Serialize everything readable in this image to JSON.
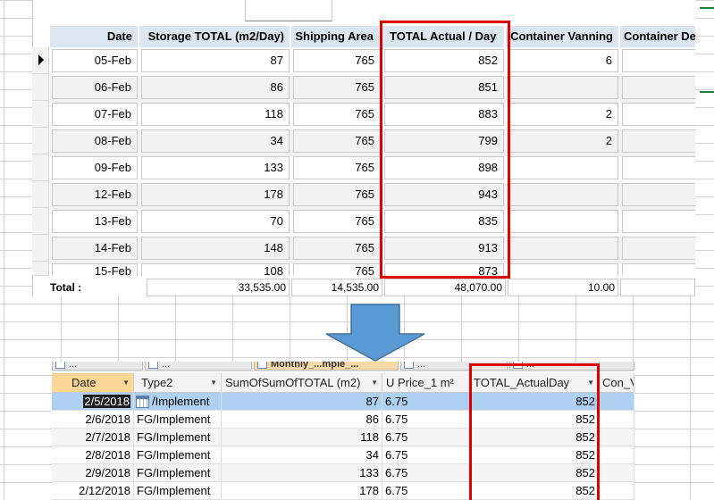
{
  "form": {
    "headers": [
      "Date",
      "Storage TOTAL (m2/Day)",
      "Shipping Area",
      "TOTAL  Actual / Day",
      "Container Vanning",
      "Container De"
    ],
    "rows": [
      [
        "05-Feb",
        "87",
        "765",
        "852",
        "6",
        ""
      ],
      [
        "06-Feb",
        "86",
        "765",
        "851",
        "",
        ""
      ],
      [
        "07-Feb",
        "118",
        "765",
        "883",
        "2",
        ""
      ],
      [
        "08-Feb",
        "34",
        "765",
        "799",
        "2",
        ""
      ],
      [
        "09-Feb",
        "133",
        "765",
        "898",
        "",
        ""
      ],
      [
        "12-Feb",
        "178",
        "765",
        "943",
        "",
        ""
      ],
      [
        "13-Feb",
        "70",
        "765",
        "835",
        "",
        ""
      ],
      [
        "14-Feb",
        "148",
        "765",
        "913",
        "",
        ""
      ],
      [
        "15-Feb",
        "108",
        "765",
        "873",
        "",
        ""
      ]
    ],
    "total_label": "Total :",
    "totals": [
      "33,535.00",
      "14,535.00",
      "48,070.00",
      "10.00"
    ]
  },
  "datasheet": {
    "tabs": [
      "...",
      "...",
      "Monthly_...mple_...",
      "...",
      "..."
    ],
    "headers": [
      "Date",
      "Type2",
      "SumOfSumOfTOTAL (m2)",
      "U Price_1 m²",
      "TOTAL_ActualDay",
      "Con_V"
    ],
    "rows": [
      [
        "2/5/2018",
        "/Implement",
        "87",
        "6.75",
        "852"
      ],
      [
        "2/6/2018",
        "FG/Implement",
        "86",
        "6.75",
        "852"
      ],
      [
        "2/7/2018",
        "FG/Implement",
        "118",
        "6.75",
        "852"
      ],
      [
        "2/8/2018",
        "FG/Implement",
        "34",
        "6.75",
        "852"
      ],
      [
        "2/9/2018",
        "FG/Implement",
        "133",
        "6.75",
        "852"
      ],
      [
        "2/12/2018",
        "FG/Implement",
        "178",
        "6.75",
        "852"
      ]
    ]
  },
  "colors": {
    "highlight": "#e00000",
    "arrow": "#5b9bd5",
    "header_blue": "#dce6f1",
    "selected_row": "#aed0f1",
    "sorted_header": "#fbd696"
  },
  "icons": [
    "record-selector-arrow-icon",
    "down-arrow-icon",
    "combo-box-icon",
    "dropdown-arrow-icon"
  ]
}
